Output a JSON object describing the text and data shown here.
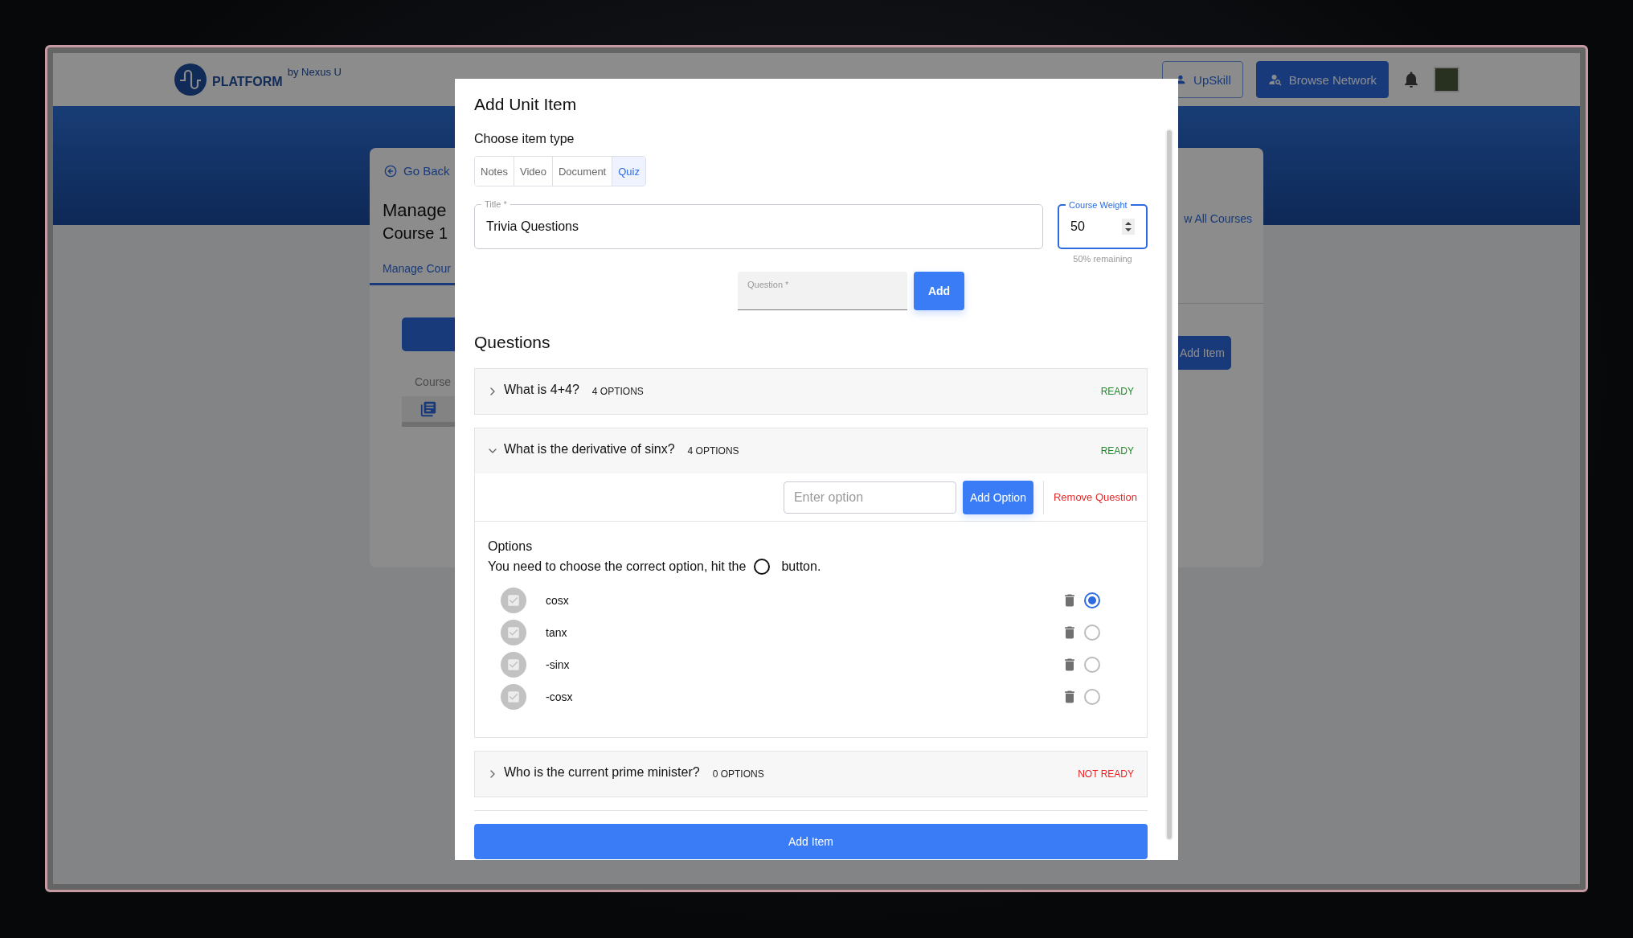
{
  "app": {
    "logo": {
      "name": "PLATFORM",
      "byline": "by Nexus U"
    },
    "header_buttons": [
      {
        "label": "UpSkill",
        "kind": "outline"
      },
      {
        "label": "Browse Network",
        "kind": "filled"
      }
    ]
  },
  "background_card": {
    "back_link": "Go Back",
    "title": "Manage",
    "subtitle": "Course 1",
    "tab": "Manage Cour",
    "section_label": "Course",
    "right_link": "w All Courses",
    "right_button": "Add Item"
  },
  "modal": {
    "title": "Add Unit Item",
    "type_label": "Choose item type",
    "item_types": [
      {
        "label": "Notes",
        "selected": false
      },
      {
        "label": "Video",
        "selected": false
      },
      {
        "label": "Document",
        "selected": false
      },
      {
        "label": "Quiz",
        "selected": true
      }
    ],
    "title_field": {
      "label": "Title *",
      "value": "Trivia Questions"
    },
    "weight_field": {
      "label": "Course Weight",
      "value": "50",
      "helper": "50% remaining"
    },
    "question_field": {
      "label": "Question *"
    },
    "add_button": "Add",
    "questions_heading": "Questions",
    "questions": [
      {
        "text": "What is 4+4?",
        "count": "4 OPTIONS",
        "status": "READY",
        "ready": true,
        "expanded": false
      },
      {
        "text": "What is the derivative of sinx?",
        "count": "4 OPTIONS",
        "status": "READY",
        "ready": true,
        "expanded": true,
        "option_input": {
          "placeholder": "Enter option"
        },
        "add_option": "Add Option",
        "remove": "Remove Question",
        "options_heading": "Options",
        "instruction_before": "You need to choose the correct option, hit the",
        "instruction_after": "button.",
        "options": [
          {
            "text": "cosx",
            "selected": true
          },
          {
            "text": "tanx",
            "selected": false
          },
          {
            "text": "-sinx",
            "selected": false
          },
          {
            "text": "-cosx",
            "selected": false
          }
        ]
      },
      {
        "text": "Who is the current prime minister?",
        "count": "0 OPTIONS",
        "status": "NOT READY",
        "ready": false,
        "expanded": false
      }
    ],
    "submit": "Add Item"
  }
}
